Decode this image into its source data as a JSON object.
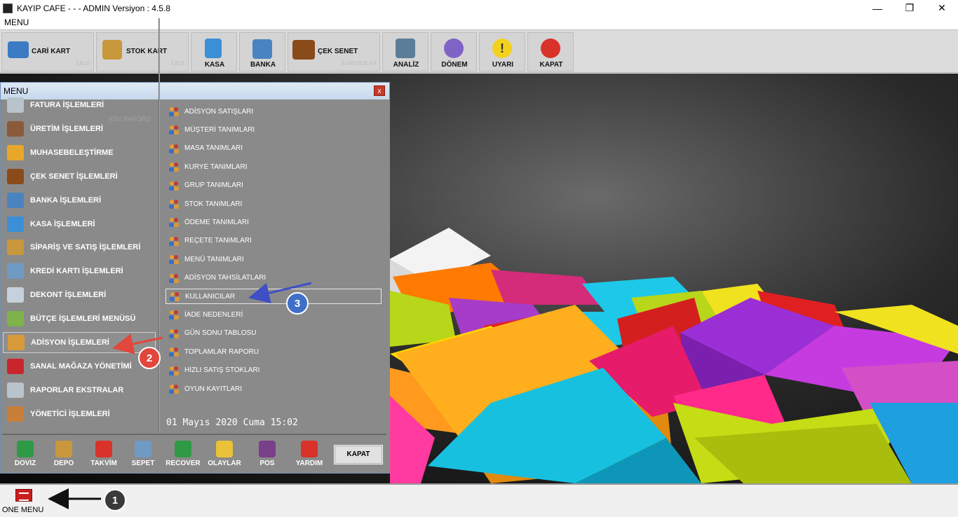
{
  "window": {
    "title": "KAYIP CAFE -  -  - ADMIN  Versiyon : 4.5.8",
    "menubar_label": "MENU"
  },
  "window_controls": {
    "minimize": "—",
    "maximize": "❐",
    "close": "✕"
  },
  "toolbar": [
    {
      "label": "CARİ KART",
      "sub": "EKLE",
      "icon": "id-card-icon",
      "color": "#3b7bc4"
    },
    {
      "label": "STOK KART",
      "sub": "EKLE",
      "icon": "box-icon",
      "color": "#c9983d"
    },
    {
      "label": "KASA",
      "sub": "",
      "icon": "cash-box-icon",
      "color": "#3b8fd6"
    },
    {
      "label": "BANKA",
      "sub": "",
      "icon": "bank-icon",
      "color": "#4a84c0"
    },
    {
      "label": "ÇEK SENET",
      "sub": "BORDROLAR",
      "icon": "briefcase-icon",
      "color": "#8a4b1a"
    },
    {
      "label": "ANALİZ",
      "sub": "",
      "icon": "analysis-icon",
      "color": "#5b7d99"
    },
    {
      "label": "DÖNEM",
      "sub": "",
      "icon": "period-icon",
      "color": "#7f63c7"
    },
    {
      "label": "UYARI",
      "sub": "",
      "icon": "warning-icon",
      "color": "#f2d21e"
    },
    {
      "label": "KAPAT",
      "sub": "",
      "icon": "power-icon",
      "color": "#d8322a"
    }
  ],
  "menu_window": {
    "title": "MENU",
    "close_label": "x",
    "ghost_text": "KDV RAPORU",
    "left_items": [
      {
        "label": "FATURA İŞLEMLERİ",
        "icon": "invoice-icon",
        "color": "#b9c3cc"
      },
      {
        "label": "ÜRETİM İŞLEMLERİ",
        "icon": "factory-icon",
        "color": "#8a5a3a"
      },
      {
        "label": "MUHASEBELEŞTİRME",
        "icon": "folder-icon",
        "color": "#e9a72a"
      },
      {
        "label": "ÇEK SENET İŞLEMLERİ",
        "icon": "briefcase-icon",
        "color": "#8a4b1a"
      },
      {
        "label": "BANKA İŞLEMLERİ",
        "icon": "bank-icon",
        "color": "#4a84c0"
      },
      {
        "label": "KASA İŞLEMLERİ",
        "icon": "cash-box-icon",
        "color": "#3b8fd6"
      },
      {
        "label": "SİPARİŞ VE SATIŞ İŞLEMLERİ",
        "icon": "order-icon",
        "color": "#c9983d"
      },
      {
        "label": "KREDİ KARTI İŞLEMLERİ",
        "icon": "credit-card-icon",
        "color": "#6f9ac4"
      },
      {
        "label": "DEKONT İŞLEMLERİ",
        "icon": "receipt-icon",
        "color": "#c5d1dc"
      },
      {
        "label": "BÜTÇE İŞLEMLERİ MENÜSÜ",
        "icon": "budget-icon",
        "color": "#7fb24a"
      },
      {
        "label": "ADİSYON İŞLEMLERİ",
        "icon": "users-icon",
        "color": "#d99a3a",
        "selected": true
      },
      {
        "label": "SANAL MAĞAZA YÖNETİMİ",
        "icon": "store-icon",
        "color": "#c8262c"
      },
      {
        "label": "RAPORLAR EKSTRALAR",
        "icon": "report-icon",
        "color": "#b9c3cc"
      },
      {
        "label": "YÖNETİCİ İŞLEMLERİ",
        "icon": "manager-icon",
        "color": "#c97e3a"
      }
    ],
    "right_items": [
      {
        "label": "ADİSYON SATIŞLARI"
      },
      {
        "label": "MÜŞTERİ TANIMLARI"
      },
      {
        "label": "MASA TANIMLARI"
      },
      {
        "label": "KURYE TANIMLARI"
      },
      {
        "label": "GRUP TANIMLARI"
      },
      {
        "label": "STOK TANIMLARI"
      },
      {
        "label": "ÖDEME TANIMLARI"
      },
      {
        "label": "REÇETE TANIMLARI"
      },
      {
        "label": "MENÜ TANIMLARI"
      },
      {
        "label": "ADİSYON TAHSİLATLARI"
      },
      {
        "label": "KULLANICILAR",
        "selected": true
      },
      {
        "label": "İADE NEDENLERİ"
      },
      {
        "label": "GÜN SONU TABLOSU"
      },
      {
        "label": "TOPLAMLAR RAPORU"
      },
      {
        "label": "HIZLI SATIŞ STOKLARI"
      },
      {
        "label": "OYUN KAYITLARI"
      }
    ],
    "datetime": "01 Mayıs 2020 Cuma 15:02",
    "bottom_buttons": [
      {
        "label": "DOVIZ",
        "icon": "currency-chart-icon",
        "color": "#2f9a45"
      },
      {
        "label": "DEPO",
        "icon": "warehouse-boxes-icon",
        "color": "#c9983d"
      },
      {
        "label": "TAKVİM",
        "icon": "calendar-icon",
        "color": "#d8322a"
      },
      {
        "label": "SEPET",
        "icon": "basket-icon",
        "color": "#6f9ac4"
      },
      {
        "label": "RECOVER",
        "icon": "recycle-icon",
        "color": "#2f9a45"
      },
      {
        "label": "OLAYLAR",
        "icon": "events-icon",
        "color": "#e9c23a"
      },
      {
        "label": "POS",
        "icon": "pos-icon",
        "color": "#7a3f8a"
      },
      {
        "label": "YARDIM",
        "icon": "help-24-7-icon",
        "color": "#d8322a"
      }
    ],
    "kapat_label": "KAPAT"
  },
  "statusbar": {
    "onemenu_label": "ONE MENU"
  },
  "annotations": [
    {
      "number": "1",
      "color": "#3a3a3a"
    },
    {
      "number": "2",
      "color": "#e2463c"
    },
    {
      "number": "3",
      "color": "#3f6fc6"
    }
  ]
}
